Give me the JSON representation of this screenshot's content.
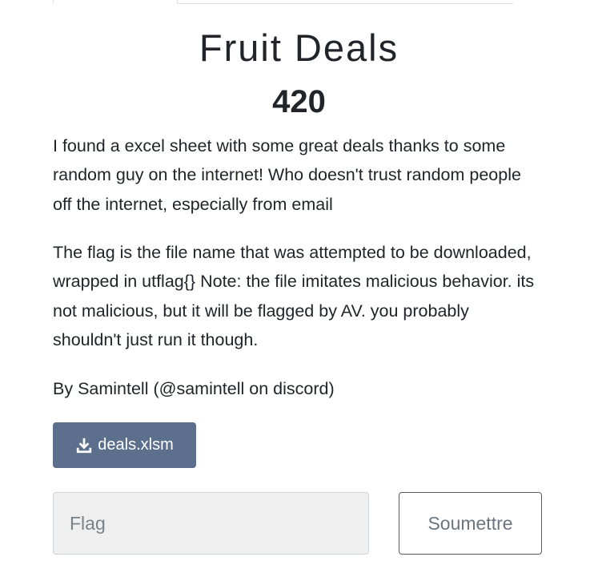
{
  "challenge": {
    "title": "Fruit Deals",
    "points": "420",
    "description": [
      "I found a excel sheet with some great deals thanks to some random guy on the internet! Who doesn't trust random people off the internet, especially from email",
      "The flag is the file name that was attempted to be downloaded, wrapped in utflag{} Note: the file imitates malicious behavior. its not malicious, but it will be flagged by AV. you probably shouldn't just run it though.",
      "By Samintell (@samintell on discord)"
    ],
    "file": {
      "name": "deals.xlsm",
      "icon": "download-icon"
    }
  },
  "submission": {
    "flag_placeholder": "Flag",
    "flag_value": "",
    "submit_label": "Soumettre"
  },
  "colors": {
    "download_button_bg": "#5c6f8c",
    "text": "#212529"
  }
}
